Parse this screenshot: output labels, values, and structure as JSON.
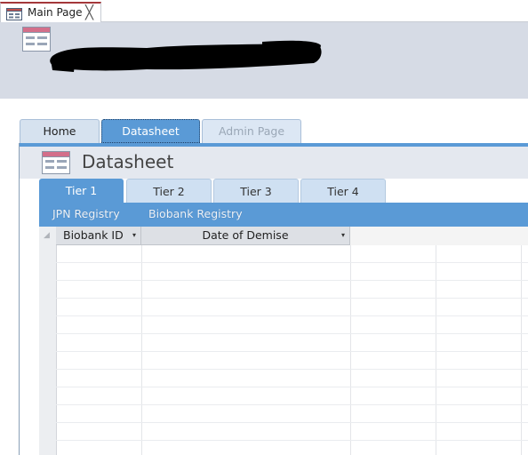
{
  "document_tab": {
    "label": "Main Page",
    "close_glyph": "╳",
    "icon": "form-icon"
  },
  "navigation": {
    "tabs": [
      {
        "label": "Home",
        "state": "normal"
      },
      {
        "label": "Datasheet",
        "state": "selected"
      },
      {
        "label": "Admin Page",
        "state": "disabled"
      }
    ]
  },
  "section": {
    "title": "Datasheet",
    "icon": "datasheet-form-icon"
  },
  "tier_tabs": [
    "Tier 1",
    "Tier 2",
    "Tier 3",
    "Tier 4"
  ],
  "active_tier": "Tier 1",
  "sub_nav": [
    "JPN Registry",
    "Biobank Registry"
  ],
  "table": {
    "columns": [
      {
        "label": "Biobank ID",
        "dropdown": "▾"
      },
      {
        "label": "Date of Demise",
        "dropdown": "▾"
      }
    ],
    "select_all_glyph": "◢"
  },
  "colors": {
    "accent_blue": "#5a9ad6",
    "header_band": "#d6dbe5",
    "tab_red_accent": "#a4373a"
  }
}
